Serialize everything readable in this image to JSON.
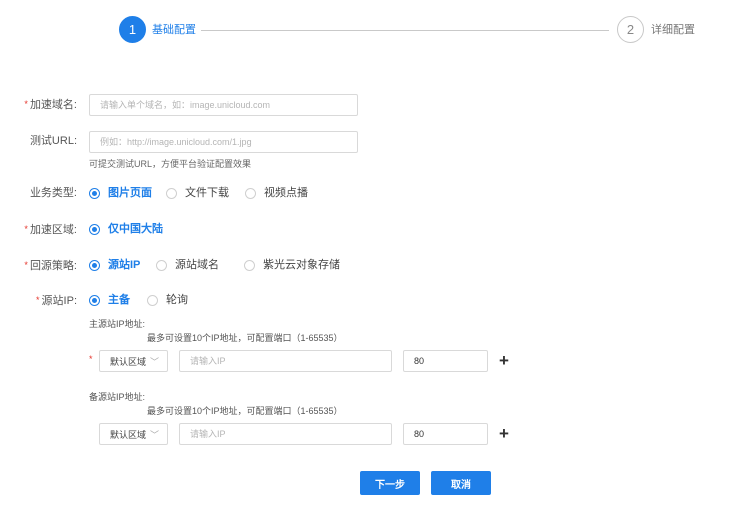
{
  "steps": [
    {
      "number": "1",
      "label": "基础配置"
    },
    {
      "number": "2",
      "label": "详细配置"
    }
  ],
  "form": {
    "domain": {
      "label": "加速域名:",
      "placeholder": "请输入单个域名，如：image.unicloud.com"
    },
    "test_url": {
      "label": "测试URL:",
      "placeholder": "例如：http://image.unicloud.com/1.jpg",
      "help": "可提交测试URL，方便平台验证配置效果"
    },
    "business_type": {
      "label": "业务类型:",
      "options": [
        "图片页面",
        "文件下载",
        "视频点播"
      ],
      "selected": "图片页面"
    },
    "region": {
      "label": "加速区域:",
      "options": [
        "仅中国大陆"
      ],
      "selected": "仅中国大陆"
    },
    "origin_policy": {
      "label": "回源策略:",
      "options": [
        "源站IP",
        "源站域名",
        "紫光云对象存储"
      ],
      "selected": "源站IP"
    },
    "origin_ip": {
      "label": "源站IP:",
      "options": [
        "主备",
        "轮询"
      ],
      "selected": "主备"
    },
    "primary": {
      "title": "主源站IP地址:",
      "hint": "最多可设置10个IP地址，可配置端口（1-65535）",
      "region": "默认区域",
      "ip_placeholder": "请输入IP",
      "port": "80"
    },
    "backup": {
      "title": "备源站IP地址:",
      "hint": "最多可设置10个IP地址，可配置端口（1-65535）",
      "region": "默认区域",
      "ip_placeholder": "请输入IP",
      "port": "80"
    }
  },
  "buttons": {
    "next": "下一步",
    "cancel": "取消"
  },
  "colors": {
    "primary": "#1f7fe8",
    "required": "#e5332a"
  },
  "icons": {
    "select_arrow": "chevron-down-icon",
    "add": "plus-icon"
  }
}
